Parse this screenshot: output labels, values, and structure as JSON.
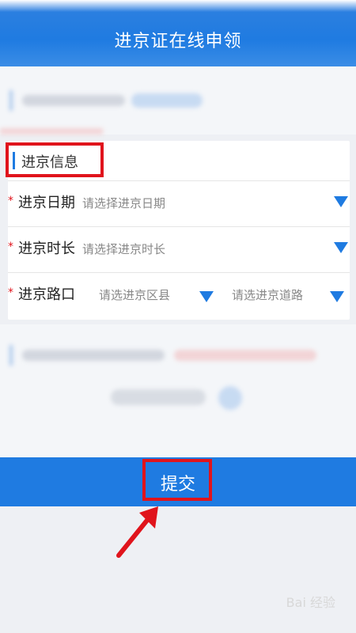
{
  "header": {
    "title": "进京证在线申领"
  },
  "form": {
    "section_title": "进京信息",
    "date": {
      "label": "进京日期",
      "placeholder": "请选择进京日期"
    },
    "duration": {
      "label": "进京时长",
      "placeholder": "请选择进京时长"
    },
    "entry": {
      "label": "进京路口",
      "district_placeholder": "请选进京区县",
      "road_placeholder": "请选进京道路"
    },
    "required_mark": "*"
  },
  "submit": {
    "label": "提交"
  },
  "colors": {
    "accent": "#1f7be1",
    "highlight": "#e0141c"
  },
  "watermark": {
    "text": "Bai 经验"
  }
}
